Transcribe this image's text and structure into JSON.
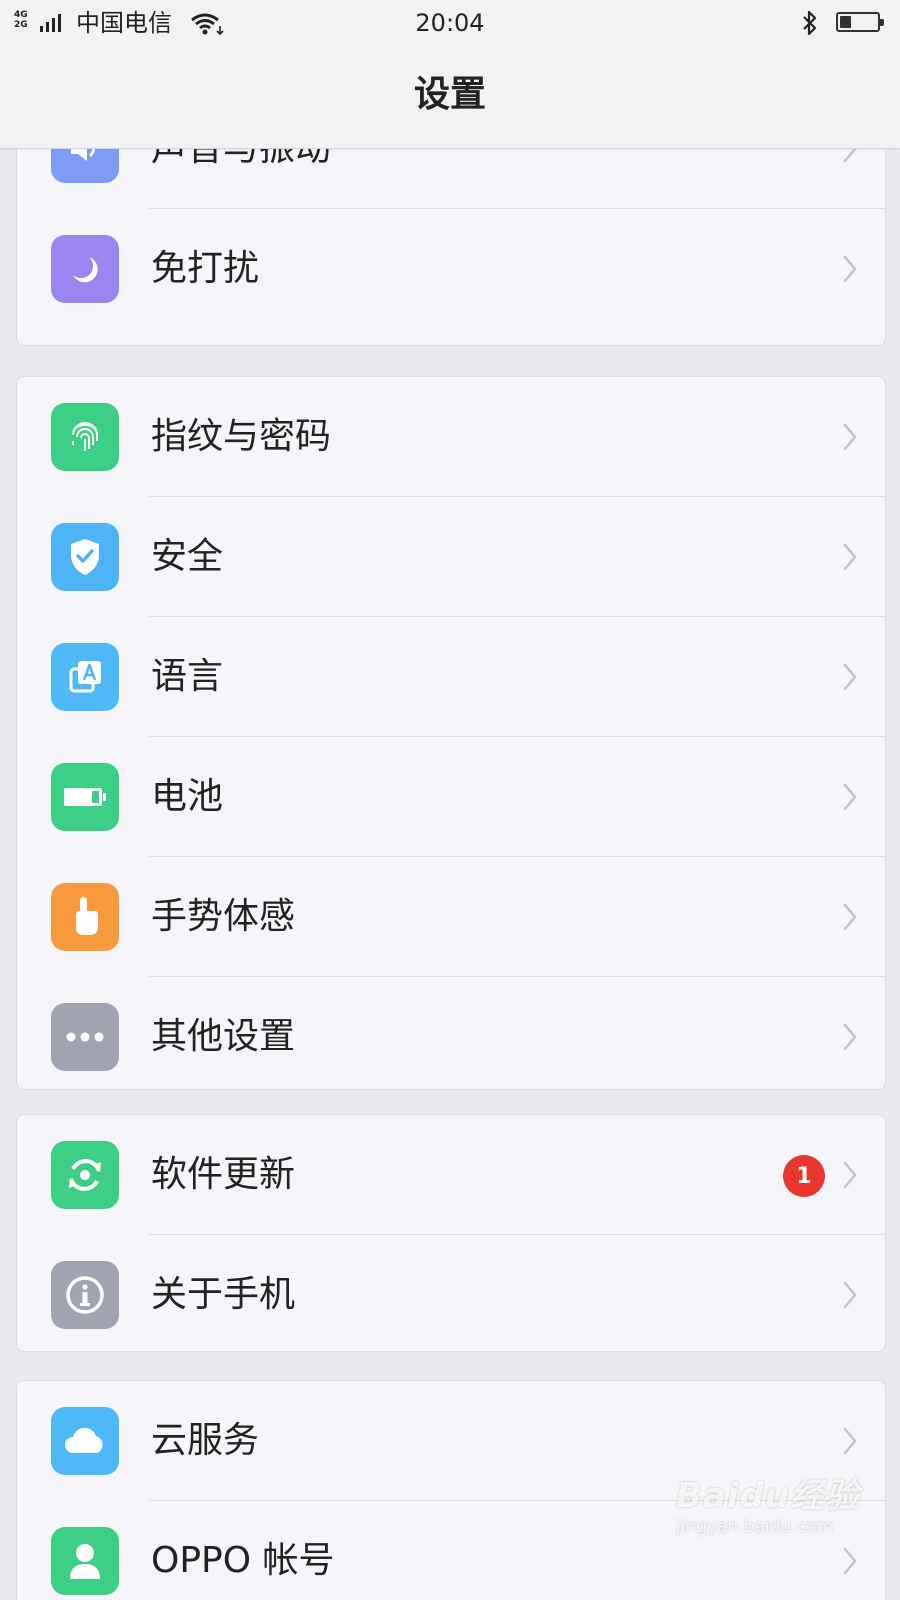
{
  "status_bar": {
    "network_top": "4G",
    "network_bottom": "2G",
    "carrier": "中国电信",
    "time": "20:04",
    "battery_level": 0.3
  },
  "header": {
    "title": "设置"
  },
  "groups": [
    {
      "items": [
        {
          "label": "声音与振动",
          "icon": "speaker-icon",
          "color": "#7f9cf5"
        },
        {
          "label": "免打扰",
          "icon": "moon-icon",
          "color": "#9b85f0"
        }
      ]
    },
    {
      "items": [
        {
          "label": "指纹与密码",
          "icon": "fingerprint-icon",
          "color": "#3ecf86"
        },
        {
          "label": "安全",
          "icon": "shield-check-icon",
          "color": "#4fb4f7"
        },
        {
          "label": "语言",
          "icon": "language-icon",
          "color": "#4fb9f7"
        },
        {
          "label": "电池",
          "icon": "battery-icon",
          "color": "#3ecf86"
        },
        {
          "label": "手势体感",
          "icon": "gesture-hand-icon",
          "color": "#f79a3e"
        },
        {
          "label": "其他设置",
          "icon": "more-dots-icon",
          "color": "#a0a4b0"
        }
      ]
    },
    {
      "items": [
        {
          "label": "软件更新",
          "icon": "update-icon",
          "color": "#3ecf86",
          "badge": "1"
        },
        {
          "label": "关于手机",
          "icon": "info-icon",
          "color": "#a0a4b0"
        }
      ]
    },
    {
      "items": [
        {
          "label": "云服务",
          "icon": "cloud-icon",
          "color": "#4fb9f7"
        },
        {
          "label": "OPPO 帐号",
          "icon": "account-icon",
          "color": "#3ecf86"
        }
      ]
    }
  ],
  "watermark": {
    "main": "Baidu经验",
    "sub": "jingyan.baidu.com"
  },
  "colors": {
    "badge": "#e8352e",
    "chevron": "#c4c4c8",
    "background": "#e9e9ee",
    "card": "#f6f5f9"
  }
}
